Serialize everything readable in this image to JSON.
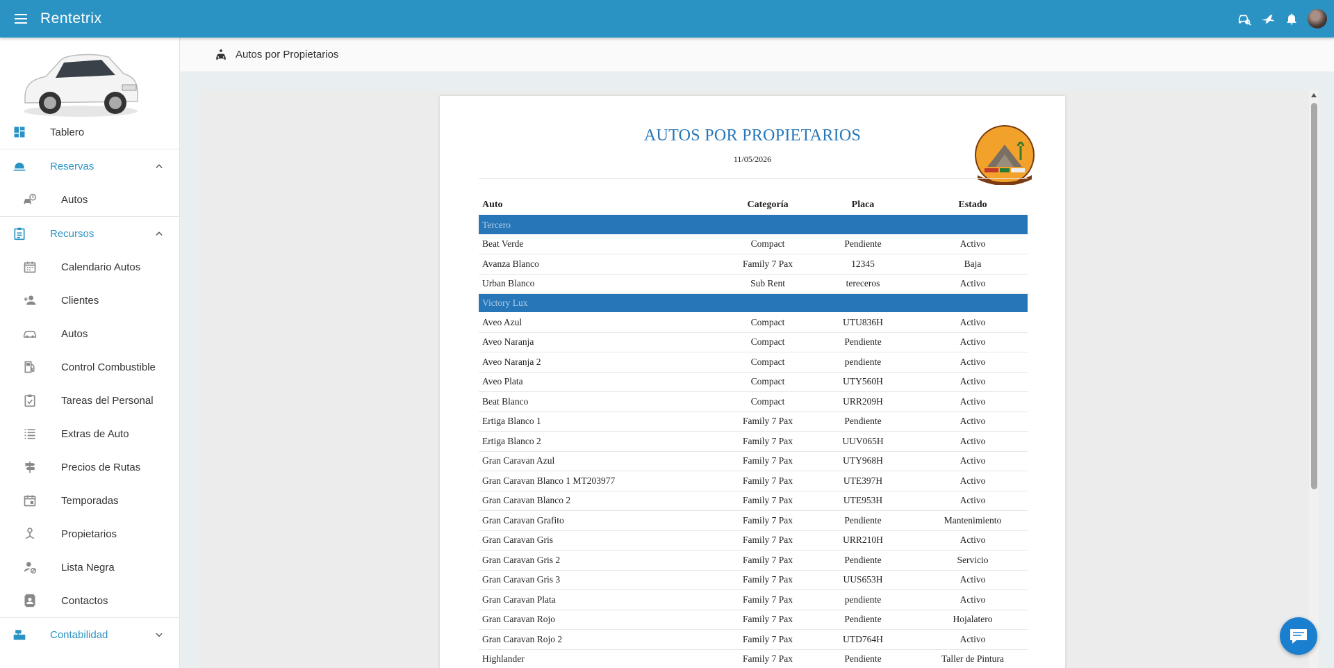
{
  "app": {
    "title": "Rentetrix"
  },
  "breadcrumb": {
    "label": "Autos por Propietarios"
  },
  "sidebar": {
    "dashboard": "Tablero",
    "reservas": {
      "label": "Reservas",
      "items": [
        "Autos"
      ]
    },
    "recursos": {
      "label": "Recursos",
      "items": [
        "Calendario Autos",
        "Clientes",
        "Autos",
        "Control Combustible",
        "Tareas del Personal",
        "Extras de Auto",
        "Precios de Rutas",
        "Temporadas",
        "Propietarios",
        "Lista Negra",
        "Contactos"
      ]
    },
    "contabilidad": {
      "label": "Contabilidad"
    }
  },
  "report": {
    "title": "AUTOS POR PROPIETARIOS",
    "date": "11/05/2026",
    "headers": {
      "auto": "Auto",
      "categoria": "Categoría",
      "placa": "Placa",
      "estado": "Estado"
    },
    "groups": [
      {
        "name": "Tercero",
        "rows": [
          [
            "Beat Verde",
            "Compact",
            "Pendiente",
            "Activo"
          ],
          [
            "Avanza Blanco",
            "Family 7 Pax",
            "12345",
            "Baja"
          ],
          [
            "Urban Blanco",
            "Sub Rent",
            "tereceros",
            "Activo"
          ]
        ]
      },
      {
        "name": "Victory Lux",
        "rows": [
          [
            "Aveo Azul",
            "Compact",
            "UTU836H",
            "Activo"
          ],
          [
            "Aveo Naranja",
            "Compact",
            "Pendiente",
            "Activo"
          ],
          [
            "Aveo Naranja 2",
            "Compact",
            "pendiente",
            "Activo"
          ],
          [
            "Aveo Plata",
            "Compact",
            "UTY560H",
            "Activo"
          ],
          [
            "Beat Blanco",
            "Compact",
            "URR209H",
            "Activo"
          ],
          [
            "Ertiga Blanco 1",
            "Family 7 Pax",
            "Pendiente",
            "Activo"
          ],
          [
            "Ertiga Blanco 2",
            "Family 7 Pax",
            "UUV065H",
            "Activo"
          ],
          [
            "Gran Caravan Azul",
            "Family 7 Pax",
            "UTY968H",
            "Activo"
          ],
          [
            "Gran Caravan Blanco 1 MT203977",
            "Family 7 Pax",
            "UTE397H",
            "Activo"
          ],
          [
            "Gran Caravan Blanco 2",
            "Family 7 Pax",
            "UTE953H",
            "Activo"
          ],
          [
            "Gran Caravan Grafito",
            "Family 7 Pax",
            "Pendiente",
            "Mantenimiento"
          ],
          [
            "Gran Caravan Gris",
            "Family 7 Pax",
            "URR210H",
            "Activo"
          ],
          [
            "Gran Caravan Gris 2",
            "Family 7 Pax",
            "Pendiente",
            "Servicio"
          ],
          [
            "Gran Caravan Gris 3",
            "Family 7 Pax",
            "UUS653H",
            "Activo"
          ],
          [
            "Gran Caravan Plata",
            "Family 7 Pax",
            "pendiente",
            "Activo"
          ],
          [
            "Gran Caravan Rojo",
            "Family 7 Pax",
            "Pendiente",
            "Hojalatero"
          ],
          [
            "Gran Caravan Rojo 2",
            "Family 7 Pax",
            "UTD764H",
            "Activo"
          ],
          [
            "Highlander",
            "Family 7 Pax",
            "Pendiente",
            "Taller de Pintura"
          ]
        ]
      }
    ]
  },
  "icons": {
    "menu": "menu-icon",
    "car_search": "car-search-icon",
    "plane": "plane-icon",
    "bell": "bell-icon",
    "chat": "chat-icon",
    "dashboard": "dashboard-icon",
    "reservas": "bell-service-icon"
  },
  "colors": {
    "primary": "#2a93c4",
    "report_accent": "#2676b8",
    "chat": "#1b7fd0"
  }
}
